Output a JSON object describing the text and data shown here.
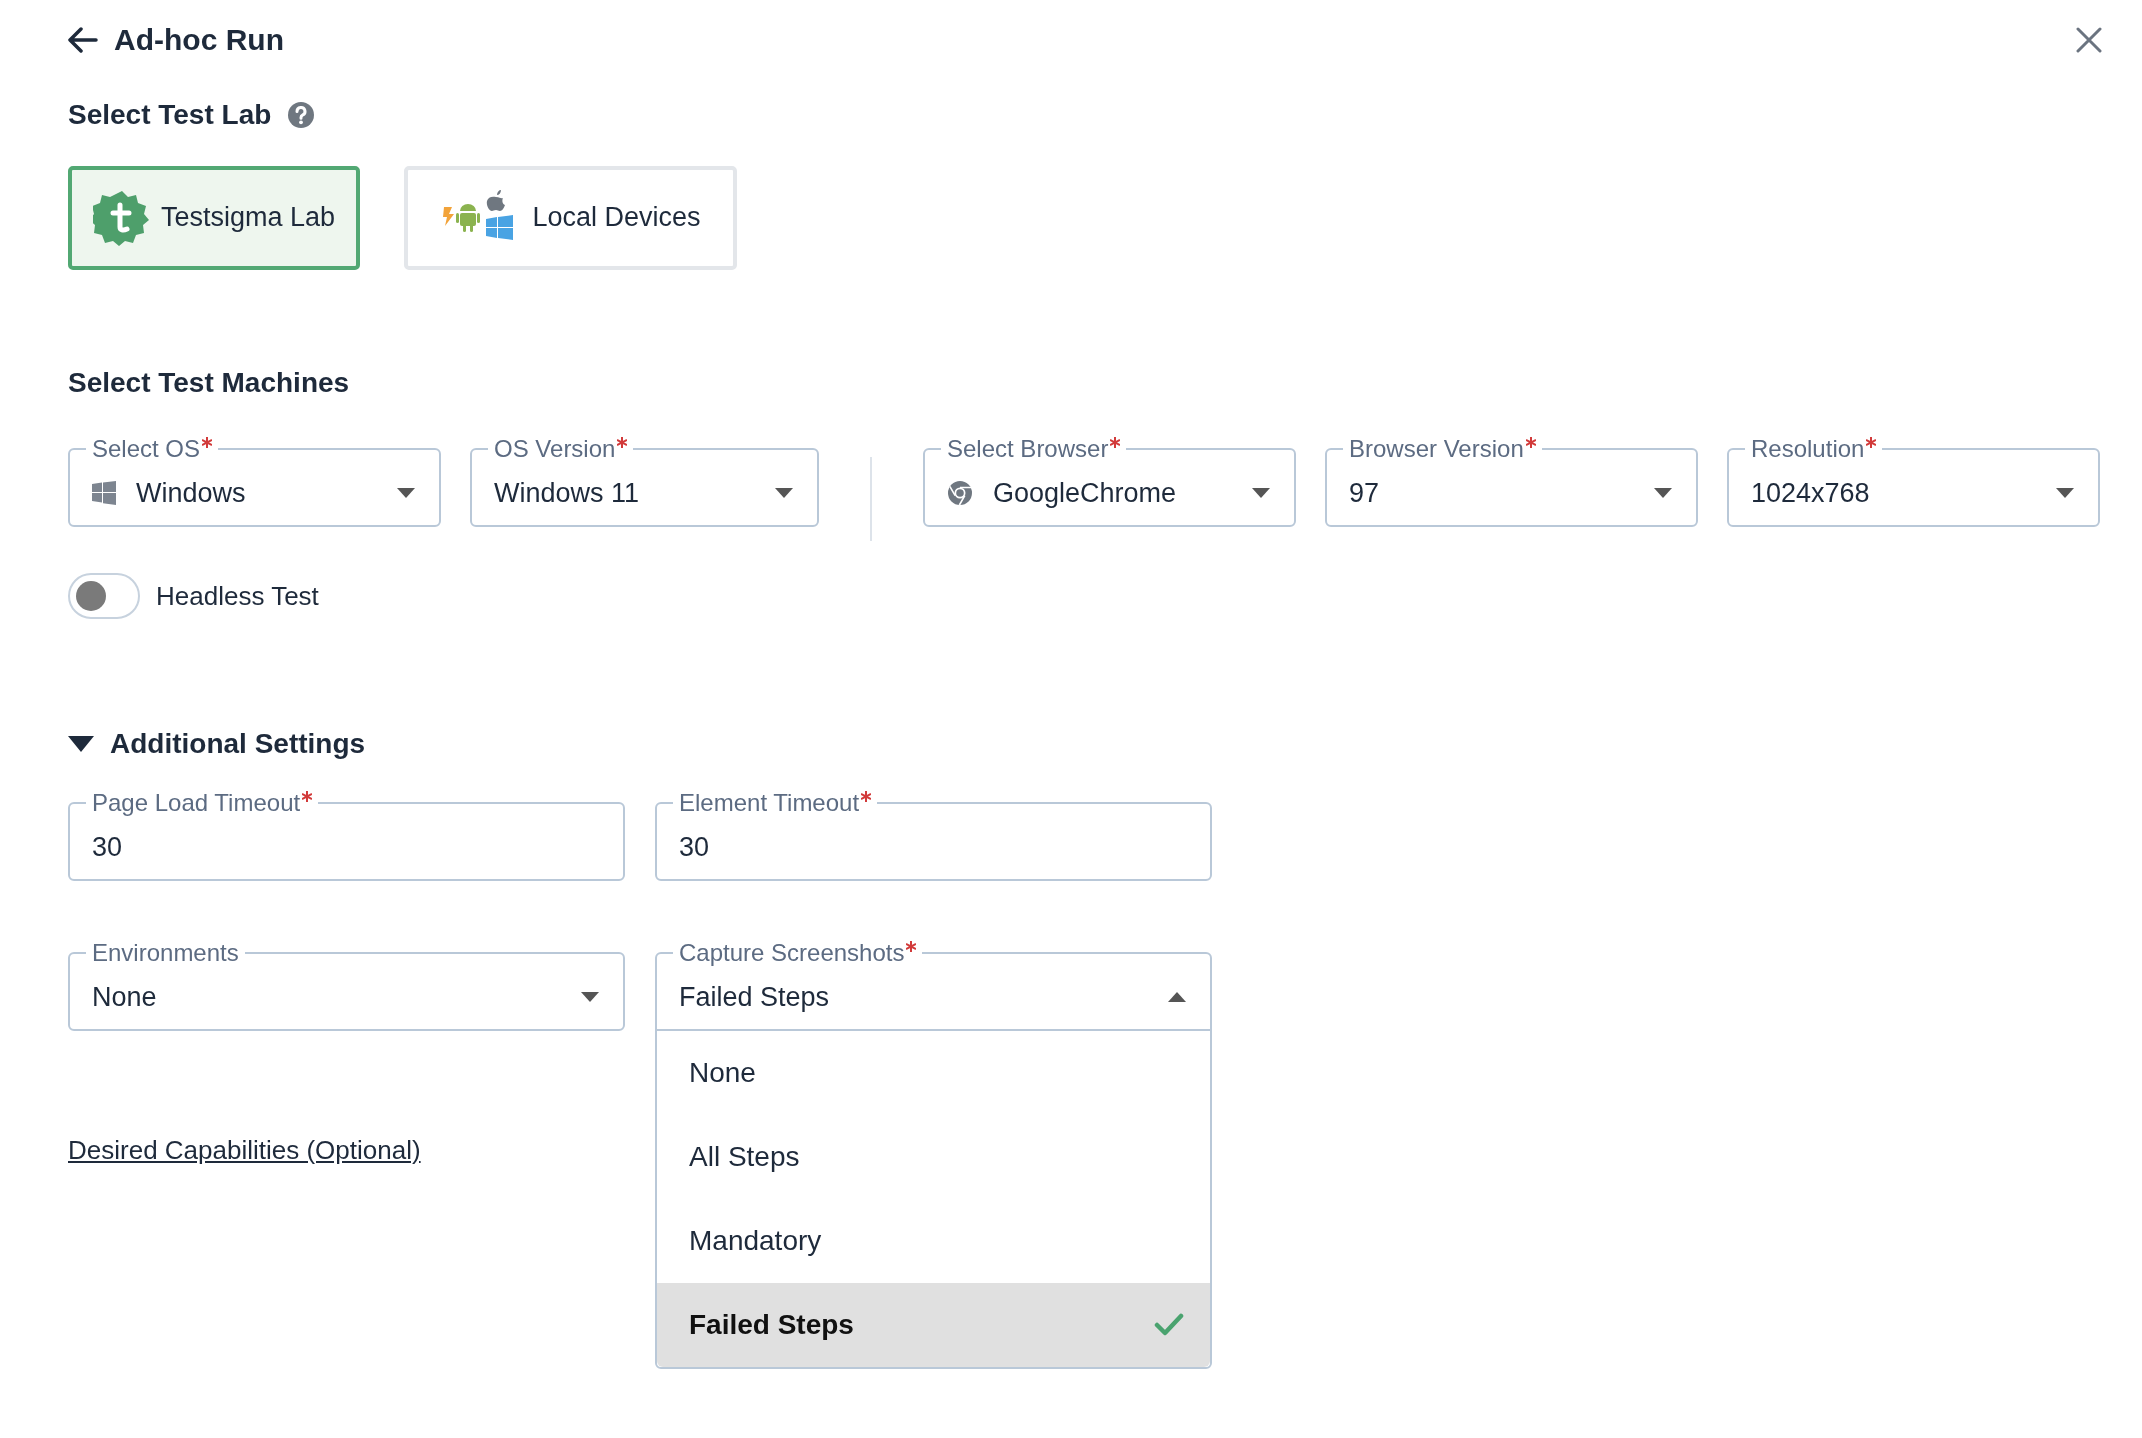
{
  "header": {
    "title": "Ad-hoc Run"
  },
  "test_lab": {
    "heading": "Select Test Lab",
    "options": [
      {
        "label": "Testsigma Lab",
        "kind": "cloud",
        "selected": true
      },
      {
        "label": "Local Devices",
        "kind": "local",
        "selected": false
      }
    ]
  },
  "test_machines": {
    "heading": "Select Test Machines",
    "fields": [
      {
        "label": "Select OS",
        "required": true,
        "value": "Windows",
        "kind": "os"
      },
      {
        "label": "OS Version",
        "required": true,
        "value": "Windows 11",
        "kind": "plain"
      },
      {
        "label": "Select Browser",
        "required": true,
        "value": "GoogleChrome",
        "kind": "browser"
      },
      {
        "label": "Browser Version",
        "required": true,
        "value": "97",
        "kind": "plain"
      },
      {
        "label": "Resolution",
        "required": true,
        "value": "1024x768",
        "kind": "plain"
      }
    ],
    "headless": {
      "label": "Headless Test",
      "on": false
    }
  },
  "additional_settings": {
    "heading": "Additional Settings",
    "expanded": true,
    "fields": [
      {
        "label": "Page Load Timeout",
        "required": true,
        "value": "30",
        "kind": "text"
      },
      {
        "label": "Element Timeout",
        "required": true,
        "value": "30",
        "kind": "text"
      },
      {
        "label": "Environments",
        "required": false,
        "value": "None",
        "kind": "select"
      },
      {
        "label": "Capture Screenshots",
        "required": true,
        "value": "Failed Steps",
        "kind": "select",
        "expanded": true,
        "options": [
          {
            "label": "None",
            "selected": false
          },
          {
            "label": "All Steps",
            "selected": false
          },
          {
            "label": "Mandatory",
            "selected": false
          },
          {
            "label": "Failed Steps",
            "selected": true
          }
        ]
      }
    ],
    "link": "Desired Capabilities (Optional)"
  }
}
